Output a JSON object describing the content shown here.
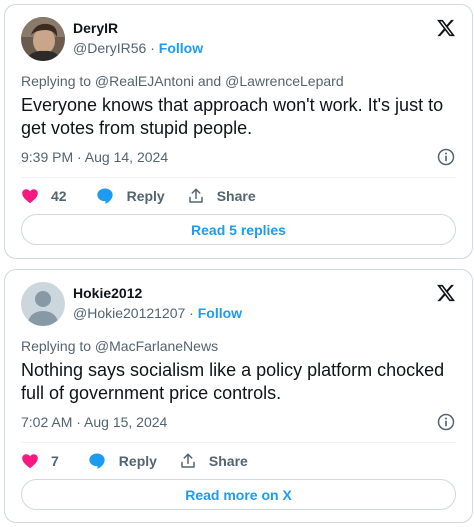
{
  "tweets": [
    {
      "name": "DeryIR",
      "handle": "@DeryIR56",
      "separator": " · ",
      "follow_label": "Follow",
      "replying_to": "Replying to @RealEJAntoni and @LawrenceLepard",
      "text": "Everyone knows that approach won't work. It's just to get votes from stupid people.",
      "timestamp": "9:39 PM · Aug 14, 2024",
      "likes": "42",
      "reply_label": "Reply",
      "share_label": "Share",
      "read_more_label": "Read 5 replies",
      "avatar_icon": "profile-photo"
    },
    {
      "name": "Hokie2012",
      "handle": "@Hokie20121207",
      "separator": " · ",
      "follow_label": "Follow",
      "replying_to": "Replying to @MacFarlaneNews",
      "text": "Nothing says socialism like a policy platform chocked full of government price controls.",
      "timestamp": "7:02 AM · Aug 15, 2024",
      "likes": "7",
      "reply_label": "Reply",
      "share_label": "Share",
      "read_more_label": "Read more on X",
      "avatar_icon": "default-avatar"
    }
  ],
  "icons": {
    "x_logo": "x-logo-icon",
    "info": "info-icon",
    "like": "heart-icon",
    "reply": "speech-bubble-icon",
    "share": "share-upload-icon"
  },
  "colors": {
    "accent": "#1d9bf0",
    "like": "#f91880",
    "text": "#0f1419",
    "muted": "#536471",
    "border": "#cfd9de"
  }
}
